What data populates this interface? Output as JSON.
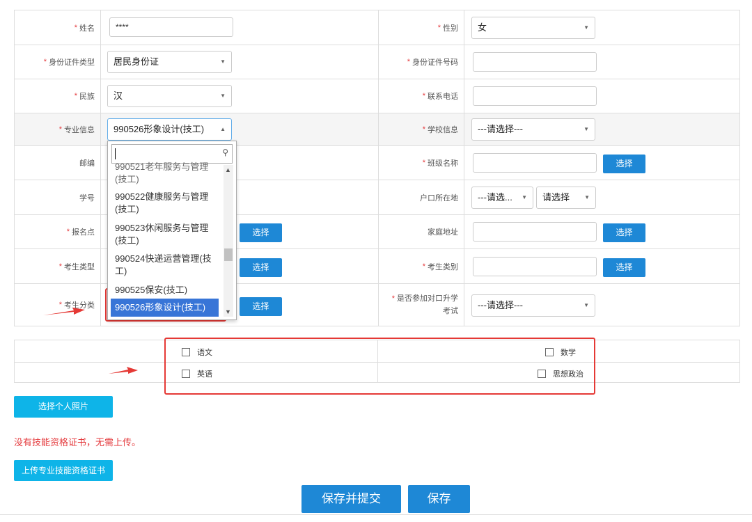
{
  "form": {
    "name_label": "姓名",
    "name_value": "****",
    "gender_label": "性别",
    "gender_value": "女",
    "idtype_label": "身份证件类型",
    "idtype_value": "居民身份证",
    "idnum_label": "身份证件号码",
    "ethnic_label": "民族",
    "ethnic_value": "汉",
    "phone_label": "联系电话",
    "major_label": "专业信息",
    "major_value": "990526形象设计(技工)",
    "school_label": "学校信息",
    "school_value": "---请选择---",
    "postcode_label": "邮编",
    "class_label": "班级名称",
    "class_btn": "选择",
    "studentno_label": "学号",
    "hukou_label": "户口所在地",
    "hukou_value1": "---请选...",
    "hukou_value2": "请选择",
    "site_label": "报名点",
    "site_btn": "选择",
    "address_label": "家庭地址",
    "address_btn": "选择",
    "examtype_label": "考生类型",
    "examtype_btn": "选择",
    "examcat_label": "考生类别",
    "examcat_btn": "选择",
    "examclass_label": "考生分类",
    "examclass_btn": "选择",
    "counterpart_label": "是否参加对口升学考试",
    "counterpart_value": "---请选择---",
    "required_mark": "*"
  },
  "dropdown": {
    "items": [
      {
        "text": "990521老年服务与管理(技工)"
      },
      {
        "text": "990522健康服务与管理(技工)"
      },
      {
        "text": "990523休闲服务与管理(技工)"
      },
      {
        "text": "990524快递运营管理(技工)"
      },
      {
        "text": "990525保安(技工)"
      },
      {
        "text": "990526形象设计(技工)"
      }
    ]
  },
  "subjects": {
    "chinese": "语文",
    "math": "数学",
    "english": "英语",
    "politics": "思想政治"
  },
  "photo_btn": "选择个人照片",
  "cert_notice": "没有技能资格证书，无需上传。",
  "upload_cert_btn": "上传专业技能资格证书",
  "save_submit_btn": "保存并提交",
  "save_btn": "保存",
  "colors": {
    "primary": "#1e88d6",
    "cyan": "#0eb4e8",
    "required": "#e4393c",
    "highlight": "#e53935",
    "selected_item": "#3875d7"
  }
}
